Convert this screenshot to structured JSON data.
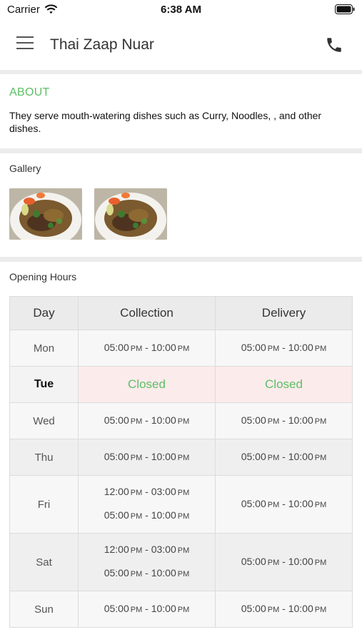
{
  "status_bar": {
    "carrier": "Carrier",
    "time": "6:38 AM"
  },
  "header": {
    "title": "Thai Zaap Nuar",
    "menu_icon": "hamburger-icon",
    "phone_icon": "phone-icon"
  },
  "about": {
    "heading": "ABOUT",
    "text": "They serve mouth-watering dishes such as Curry, Noodles, ,  and other dishes."
  },
  "gallery": {
    "heading": "Gallery",
    "images": [
      "food-photo",
      "food-photo"
    ]
  },
  "opening_hours": {
    "heading": "Opening Hours",
    "columns": [
      "Day",
      "Collection",
      "Delivery"
    ],
    "rows": [
      {
        "day": "Mon",
        "collection": [
          [
            "05:00",
            "PM",
            "10:00",
            "PM"
          ]
        ],
        "delivery": [
          [
            "05:00",
            "PM",
            "10:00",
            "PM"
          ]
        ]
      },
      {
        "day": "Tue",
        "closed": true,
        "collection_text": "Closed",
        "delivery_text": "Closed"
      },
      {
        "day": "Wed",
        "collection": [
          [
            "05:00",
            "PM",
            "10:00",
            "PM"
          ]
        ],
        "delivery": [
          [
            "05:00",
            "PM",
            "10:00",
            "PM"
          ]
        ]
      },
      {
        "day": "Thu",
        "collection": [
          [
            "05:00",
            "PM",
            "10:00",
            "PM"
          ]
        ],
        "delivery": [
          [
            "05:00",
            "PM",
            "10:00",
            "PM"
          ]
        ]
      },
      {
        "day": "Fri",
        "collection": [
          [
            "12:00",
            "PM",
            "03:00",
            "PM"
          ],
          [
            "05:00",
            "PM",
            "10:00",
            "PM"
          ]
        ],
        "delivery": [
          [
            "05:00",
            "PM",
            "10:00",
            "PM"
          ]
        ]
      },
      {
        "day": "Sat",
        "collection": [
          [
            "12:00",
            "PM",
            "03:00",
            "PM"
          ],
          [
            "05:00",
            "PM",
            "10:00",
            "PM"
          ]
        ],
        "delivery": [
          [
            "05:00",
            "PM",
            "10:00",
            "PM"
          ]
        ]
      },
      {
        "day": "Sun",
        "collection": [
          [
            "05:00",
            "PM",
            "10:00",
            "PM"
          ]
        ],
        "delivery": [
          [
            "05:00",
            "PM",
            "10:00",
            "PM"
          ]
        ]
      }
    ]
  },
  "colors": {
    "accent": "#5cbf65",
    "closed_bg": "#fcebeb",
    "header_bg": "#ebebeb"
  }
}
